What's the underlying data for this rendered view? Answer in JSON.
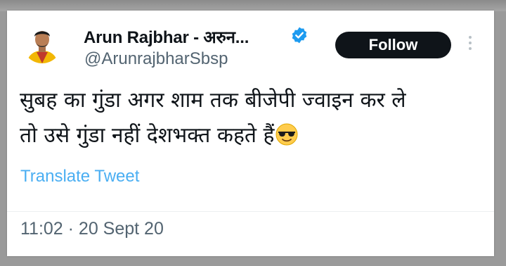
{
  "tweet": {
    "author": {
      "display_name": "Arun Rajbhar - अरुन...",
      "handle": "@ArunrajbharSbsp",
      "verified": true,
      "avatar_icon": "profile-photo"
    },
    "follow_label": "Follow",
    "more_icon": "more-options-icon",
    "text_lines": [
      "सुबह का गुंडा अगर शाम तक बीजेपी ज्वाइन कर ले",
      "तो उसे गुंडा नहीं देशभक्त कहते हैं"
    ],
    "emoji": "smiling-face-with-sunglasses",
    "translate_label": "Translate Tweet",
    "timestamp": "11:02 · 20 Sept 20"
  },
  "colors": {
    "verified": "#1d9bf0",
    "follow_bg": "#0f1419",
    "link": "#1d9bf0",
    "muted_text": "#536471",
    "frame": "#9a9a9a"
  }
}
